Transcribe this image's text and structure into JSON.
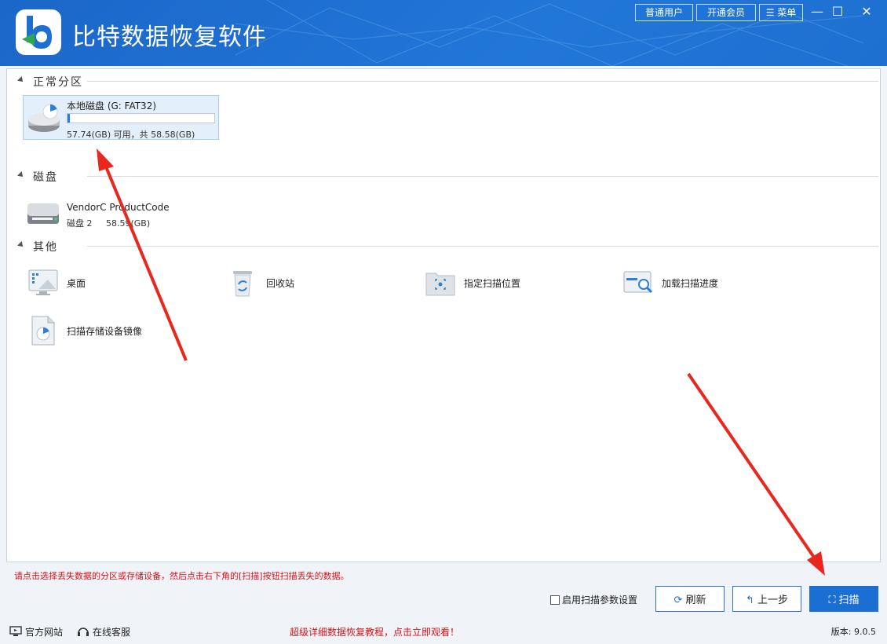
{
  "app": {
    "title": "比特数据恢复软件"
  },
  "titlebar": {
    "user_btn": "普通用户",
    "vip_btn": "开通会员",
    "menu_btn": "菜单"
  },
  "sections": {
    "partitions_label": "正常分区",
    "disks_label": "磁盘",
    "other_label": "其他"
  },
  "partition": {
    "name": "本地磁盘 (G: FAT32)",
    "capacity": "57.74(GB) 可用，共 58.58(GB)",
    "used_fraction": 0.014
  },
  "disk": {
    "name": "VendorC ProductCode",
    "sub": "磁盘 2     58.59(GB)"
  },
  "other": {
    "desktop": "桌面",
    "recycle": "回收站",
    "location": "指定扫描位置",
    "progress": "加载扫描进度",
    "image": "扫描存储设备镜像"
  },
  "hint": "请点击选择丢失数据的分区或存储设备，然后点击右下角的[扫描]按钮扫描丢失的数据。",
  "controls": {
    "scan_params": "启用扫描参数设置",
    "refresh": "刷新",
    "back": "上一步",
    "scan": "扫描"
  },
  "footer": {
    "website": "官方网站",
    "support": "在线客服",
    "promo": "超级详细数据恢复教程，点击立即观看！",
    "version": "版本: 9.0.5"
  },
  "colors": {
    "accent": "#1b6fd3",
    "warning": "#d4141a",
    "arrow": "#e8271f"
  }
}
